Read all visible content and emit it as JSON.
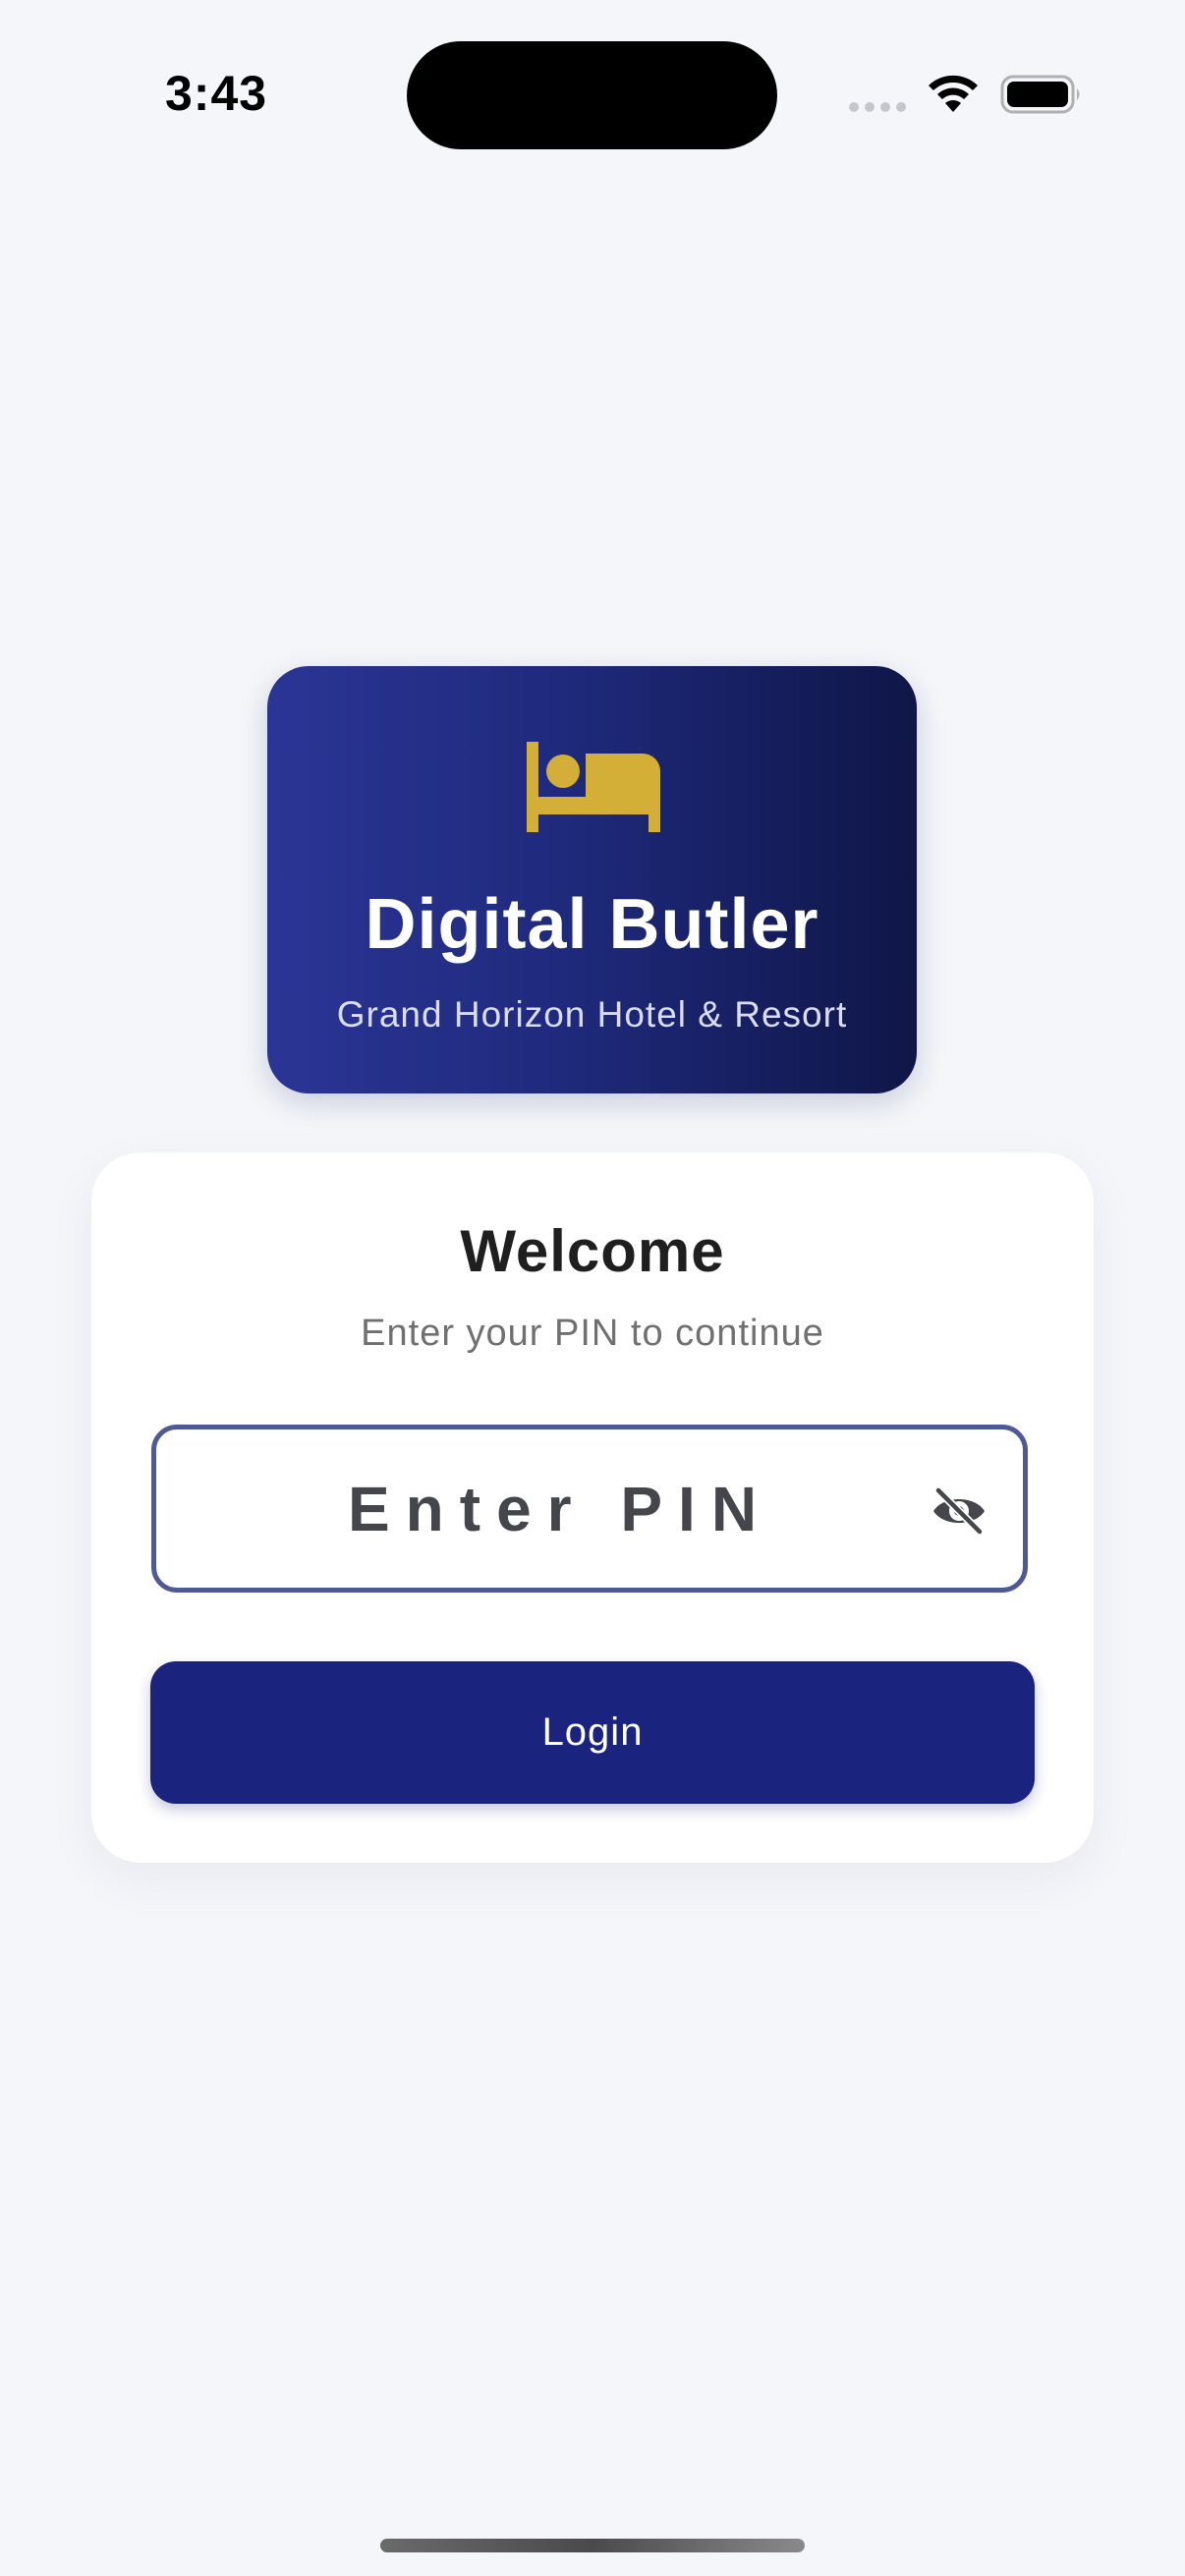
{
  "status_bar": {
    "time": "3:43",
    "icons": [
      "cellular-signal-icon",
      "wifi-icon",
      "battery-icon"
    ]
  },
  "brand": {
    "icon": "bed-icon",
    "title": "Digital Butler",
    "subtitle": "Grand Horizon Hotel & Resort",
    "colors": {
      "gradient_start": "#2b3595",
      "gradient_end": "#0f1647",
      "icon": "#d4af37"
    }
  },
  "login": {
    "title": "Welcome",
    "subtitle": "Enter your PIN to continue",
    "pin_value": "",
    "pin_placeholder": "Enter PIN",
    "visibility_icon": "eye-off-icon",
    "button_label": "Login",
    "colors": {
      "button": "#1a237e",
      "field_border": "#4f5a95"
    }
  }
}
